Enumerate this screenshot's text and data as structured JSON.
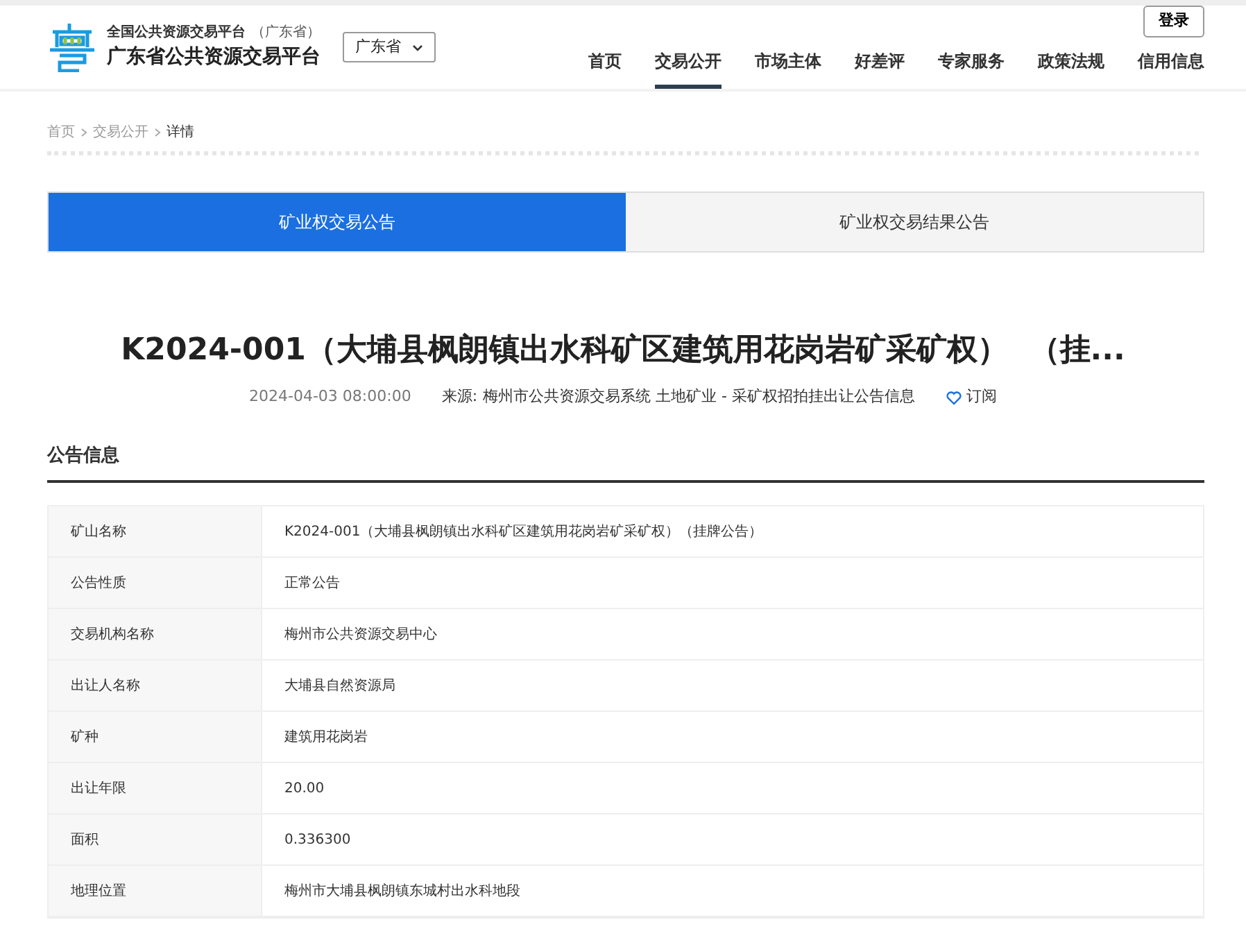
{
  "header": {
    "logo_small_title": "全国公共资源交易平台",
    "logo_small_region": "（广东省）",
    "logo_title": "广东省公共资源交易平台",
    "region_select": "广东省",
    "login": "登录",
    "nav": [
      {
        "label": "首页",
        "selected": false
      },
      {
        "label": "交易公开",
        "selected": true
      },
      {
        "label": "市场主体",
        "selected": false
      },
      {
        "label": "好差评",
        "selected": false
      },
      {
        "label": "专家服务",
        "selected": false
      },
      {
        "label": "政策法规",
        "selected": false
      },
      {
        "label": "信用信息",
        "selected": false
      }
    ]
  },
  "breadcrumb": [
    "首页",
    "交易公开",
    "详情"
  ],
  "tabs": [
    {
      "label": "矿业权交易公告",
      "selected": true
    },
    {
      "label": "矿业权交易结果公告",
      "selected": false
    }
  ],
  "article": {
    "title": "K2024-001（大埔县枫朗镇出水科矿区建筑用花岗岩矿采矿权）  （挂...",
    "date": "2024-04-03 08:00:00",
    "source_label": "来源:",
    "source": "梅州市公共资源交易系统 土地矿业 - 采矿权招拍挂出让公告信息",
    "subscribe": "订阅"
  },
  "section_title": "公告信息",
  "info_rows": [
    {
      "label": "矿山名称",
      "value": "K2024-001（大埔县枫朗镇出水科矿区建筑用花岗岩矿采矿权）（挂牌公告）"
    },
    {
      "label": "公告性质",
      "value": "正常公告"
    },
    {
      "label": "交易机构名称",
      "value": "梅州市公共资源交易中心"
    },
    {
      "label": "出让人名称",
      "value": "大埔县自然资源局"
    },
    {
      "label": "矿种",
      "value": "建筑用花岗岩"
    },
    {
      "label": "出让年限",
      "value": "20.00"
    },
    {
      "label": "面积",
      "value": "0.336300"
    },
    {
      "label": "地理位置",
      "value": "梅州市大埔县枫朗镇东城村出水科地段"
    }
  ]
}
